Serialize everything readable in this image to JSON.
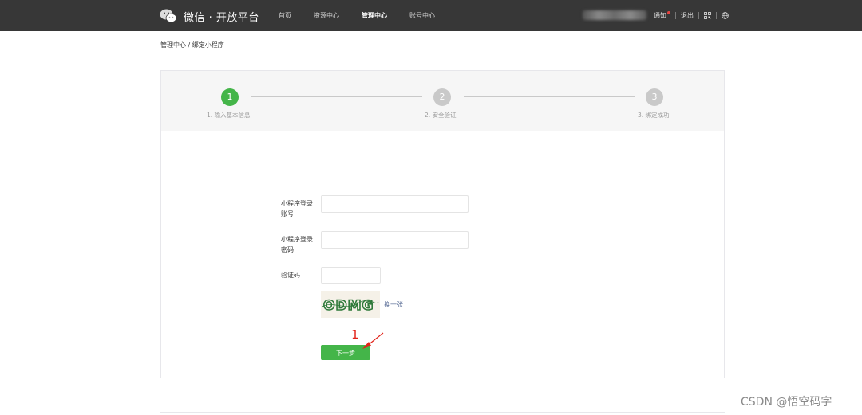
{
  "header": {
    "logo_text": "微信 · 开放平台",
    "nav": [
      {
        "label": "首页",
        "active": false
      },
      {
        "label": "资源中心",
        "active": false
      },
      {
        "label": "管理中心",
        "active": true
      },
      {
        "label": "账号中心",
        "active": false
      }
    ],
    "notice_label": "通知",
    "logout_label": "退出"
  },
  "breadcrumb": {
    "text": "管理中心 / 绑定小程序"
  },
  "steps": [
    {
      "number": "1",
      "label": "1. 输入基本信息",
      "state": "current"
    },
    {
      "number": "2",
      "label": "2. 安全验证",
      "state": "pending"
    },
    {
      "number": "3",
      "label": "3. 绑定成功",
      "state": "pending"
    }
  ],
  "form": {
    "account_label_line1": "小程序登录",
    "account_label_line2": "账号",
    "account_value": "",
    "password_label_line1": "小程序登录",
    "password_label_line2": "密码",
    "password_value": "",
    "captcha_label": "验证码",
    "captcha_value": "",
    "captcha_image_text": "ODMG",
    "change_link": "换一张",
    "next_button": "下一步"
  },
  "annotation": {
    "number": "1"
  },
  "watermark": "CSDN @悟空码字",
  "colors": {
    "topbar": "#373737",
    "accent_green": "#44b549",
    "step_pending": "#c9c9c9",
    "link_blue": "#576b95",
    "annotation_red": "#e2231a"
  }
}
